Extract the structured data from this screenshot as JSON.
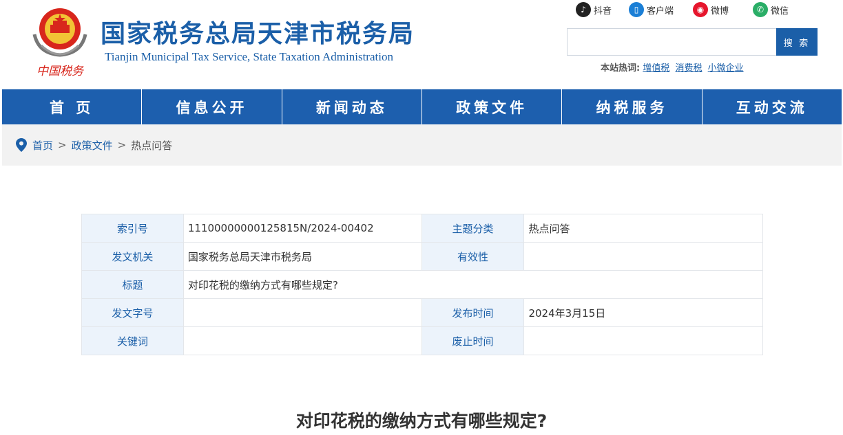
{
  "header": {
    "title": "国家税务总局天津市税务局",
    "subtitle": "Tianjin Municipal Tax Service, State Taxation Administration",
    "emblem_text": "中国税务",
    "social": [
      {
        "label": "抖音",
        "icon": "douyin-icon",
        "color": "#222222"
      },
      {
        "label": "客户端",
        "icon": "mobile-client-icon",
        "color": "#1b7fd6"
      },
      {
        "label": "微博",
        "icon": "weibo-icon",
        "color": "#e6162d"
      },
      {
        "label": "微信",
        "icon": "wechat-icon",
        "color": "#2aae67"
      }
    ],
    "search": {
      "placeholder": "",
      "button_label": "搜 索"
    },
    "hot": {
      "label": "本站热词:",
      "items": [
        "增值税",
        "消费税",
        "小微企业"
      ]
    }
  },
  "nav": [
    "首 页",
    "信息公开",
    "新闻动态",
    "政策文件",
    "纳税服务",
    "互动交流"
  ],
  "breadcrumb": {
    "items": [
      "首页",
      "政策文件"
    ],
    "current": "热点问答",
    "separator": ">"
  },
  "info": {
    "index_label": "索引号",
    "index_value": "11100000000125815N/2024-00402",
    "subject_label": "主题分类",
    "subject_value": "热点问答",
    "issuer_label": "发文机关",
    "issuer_value": "国家税务总局天津市税务局",
    "validity_label": "有效性",
    "validity_value": "",
    "title_label": "标题",
    "title_value": "对印花税的缴纳方式有哪些规定?",
    "docno_label": "发文字号",
    "docno_value": "",
    "publish_label": "发布时间",
    "publish_value": "2024年3月15日",
    "keywords_label": "关键词",
    "keywords_value": "",
    "repeal_label": "废止时间",
    "repeal_value": ""
  },
  "article": {
    "title": "对印花税的缴纳方式有哪些规定?"
  },
  "colors": {
    "brand_blue": "#1b5fa8",
    "nav_blue": "#1d5fae",
    "label_bg": "#ecf3fb"
  }
}
